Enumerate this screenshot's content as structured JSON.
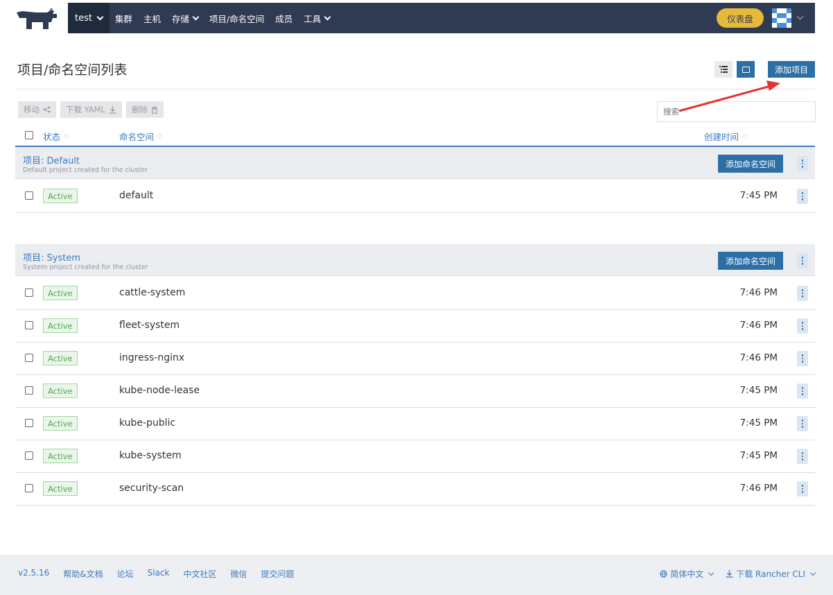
{
  "header": {
    "cluster": "test",
    "nav": [
      {
        "label": "集群",
        "dropdown": false
      },
      {
        "label": "主机",
        "dropdown": false
      },
      {
        "label": "存储",
        "dropdown": true
      },
      {
        "label": "项目/命名空间",
        "dropdown": false
      },
      {
        "label": "成员",
        "dropdown": false
      },
      {
        "label": "工具",
        "dropdown": true
      }
    ],
    "dashboard_label": "仪表盘"
  },
  "page": {
    "title": "项目/命名空间列表",
    "add_project_label": "添加项目",
    "search_placeholder": "搜索"
  },
  "bulk_actions": {
    "move": "移动",
    "download_yaml": "下载 YAML",
    "delete": "删除"
  },
  "table": {
    "col_state": "状态",
    "col_namespace": "命名空间",
    "col_created": "创建时间"
  },
  "groups": [
    {
      "title": "项目: Default",
      "description": "Default project created for the cluster",
      "add_ns_label": "添加命名空间",
      "rows": [
        {
          "state": "Active",
          "name": "default",
          "created": "7:45 PM"
        }
      ]
    },
    {
      "title": "项目: System",
      "description": "System project created for the cluster",
      "add_ns_label": "添加命名空间",
      "rows": [
        {
          "state": "Active",
          "name": "cattle-system",
          "created": "7:46 PM"
        },
        {
          "state": "Active",
          "name": "fleet-system",
          "created": "7:46 PM"
        },
        {
          "state": "Active",
          "name": "ingress-nginx",
          "created": "7:46 PM"
        },
        {
          "state": "Active",
          "name": "kube-node-lease",
          "created": "7:45 PM"
        },
        {
          "state": "Active",
          "name": "kube-public",
          "created": "7:45 PM"
        },
        {
          "state": "Active",
          "name": "kube-system",
          "created": "7:45 PM"
        },
        {
          "state": "Active",
          "name": "security-scan",
          "created": "7:46 PM"
        }
      ]
    }
  ],
  "footer": {
    "version": "v2.5.16",
    "links": [
      "帮助&文档",
      "论坛",
      "Slack",
      "中文社区",
      "微信",
      "提交问题"
    ],
    "language": "简体中文",
    "download_cli": "下载 Rancher CLI"
  },
  "colors": {
    "navbar": "#2f3b52",
    "primary": "#2c6ea6",
    "link": "#3d7bbf",
    "dashboard": "#e7b93a",
    "active_badge": "#55a455",
    "annotation_arrow": "#e5322d"
  }
}
